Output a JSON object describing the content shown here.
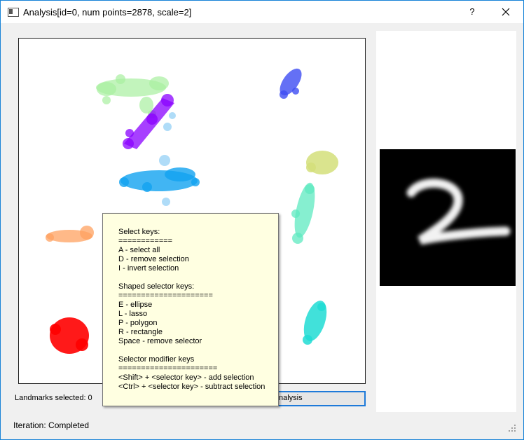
{
  "window": {
    "title": "Analysis[id=0, num points=2878, scale=2]",
    "help_label": "?",
    "close_icon": "close-icon",
    "accent_color": "#1883d7"
  },
  "plot": {
    "clusters": [
      {
        "color": "#a8f0a0",
        "shape": "blob"
      },
      {
        "color": "#8a00ff",
        "shape": "stroke"
      },
      {
        "color": "#3d4cf2",
        "shape": "blob"
      },
      {
        "color": "#12a3f0",
        "shape": "blob"
      },
      {
        "color": "#d3df7a",
        "shape": "blob"
      },
      {
        "color": "#5ee9c0",
        "shape": "stroke"
      },
      {
        "color": "#ffa260",
        "shape": "blob"
      },
      {
        "color": "#ff0000",
        "shape": "blob"
      },
      {
        "color": "#20dcd4",
        "shape": "blob"
      }
    ]
  },
  "preview": {
    "description_icon": "digit-two-image"
  },
  "bottom": {
    "landmarks_label": "Landmarks selected: 0",
    "analysis_button_label": "nalysis"
  },
  "status": {
    "text": "Iteration: Completed"
  },
  "tooltip": {
    "text": "Select keys:\n============\nA - select all\nD - remove selection\nI - invert selection\n\nShaped selector keys:\n=====================\nE - ellipse\nL - lasso\nP - polygon\nR - rectangle\nSpace - remove selector\n\nSelector modifier keys\n======================\n<Shift> + <selector key> - add selection\n<Ctrl> + <selector key> - subtract selection"
  }
}
